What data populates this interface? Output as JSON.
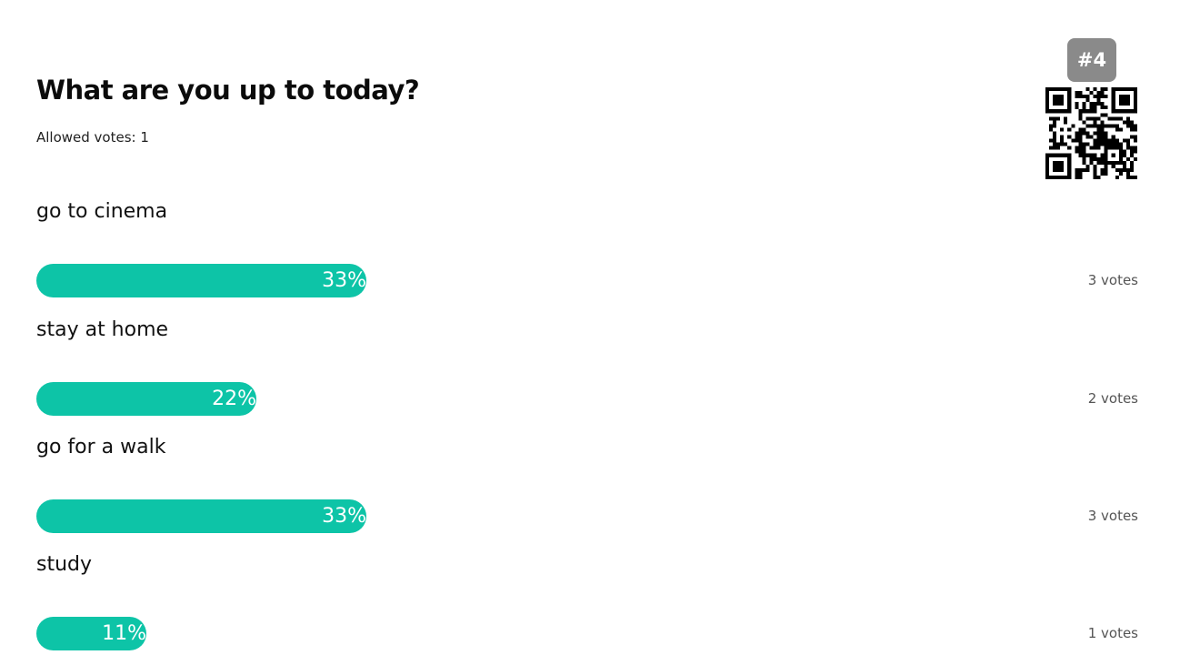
{
  "poll": {
    "title": "What are you up to today?",
    "allowed_votes_text": "Allowed votes: 1",
    "badge": "#4"
  },
  "options": [
    {
      "label": "go to cinema",
      "percent": 33,
      "percent_text": "33%",
      "votes_text": "3 votes"
    },
    {
      "label": "stay at home",
      "percent": 22,
      "percent_text": "22%",
      "votes_text": "2 votes"
    },
    {
      "label": "go for a walk",
      "percent": 33,
      "percent_text": "33%",
      "votes_text": "3 votes"
    },
    {
      "label": "study",
      "percent": 11,
      "percent_text": "11%",
      "votes_text": "1 votes"
    }
  ],
  "colors": {
    "bar": "#0dc4a7",
    "badge": "#8a8a8a"
  },
  "icons": {
    "qr": "qr-code-icon"
  }
}
